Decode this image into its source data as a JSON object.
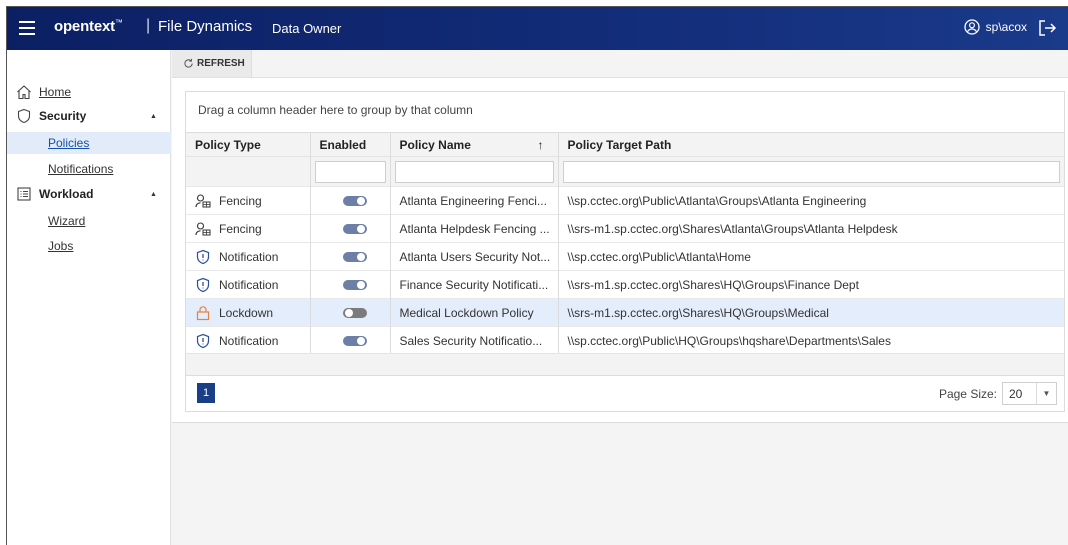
{
  "header": {
    "brand": "opentext",
    "brand_mark": "™",
    "separator": "|",
    "product": "File Dynamics",
    "role": "Data Owner",
    "user": "sp\\acox"
  },
  "sidebar": {
    "home": "Home",
    "security": "Security",
    "policies": "Policies",
    "notifications": "Notifications",
    "workload": "Workload",
    "wizard": "Wizard",
    "jobs": "Jobs"
  },
  "toolbar": {
    "refresh_label": "REFRESH"
  },
  "grid": {
    "group_hint": "Drag a column header here to group by that column",
    "columns": [
      "Policy Type",
      "Enabled",
      "Policy Name",
      "Policy Target Path"
    ],
    "sort_indicator": "↑",
    "rows": [
      {
        "type": "Fencing",
        "icon": "fencing-icon",
        "enabled": true,
        "name": "Atlanta Engineering Fenci...",
        "path": "\\\\sp.cctec.org\\Public\\Atlanta\\Groups\\Atlanta Engineering"
      },
      {
        "type": "Fencing",
        "icon": "fencing-icon",
        "enabled": true,
        "name": "Atlanta Helpdesk Fencing ...",
        "path": "\\\\srs-m1.sp.cctec.org\\Shares\\Atlanta\\Groups\\Atlanta Helpdesk"
      },
      {
        "type": "Notification",
        "icon": "shield-icon",
        "enabled": true,
        "name": "Atlanta Users Security Not...",
        "path": "\\\\sp.cctec.org\\Public\\Atlanta\\Home"
      },
      {
        "type": "Notification",
        "icon": "shield-icon",
        "enabled": true,
        "name": "Finance Security Notificati...",
        "path": "\\\\srs-m1.sp.cctec.org\\Shares\\HQ\\Groups\\Finance Dept"
      },
      {
        "type": "Lockdown",
        "icon": "lock-icon",
        "enabled": false,
        "name": "Medical Lockdown Policy",
        "path": "\\\\srs-m1.sp.cctec.org\\Shares\\HQ\\Groups\\Medical"
      },
      {
        "type": "Notification",
        "icon": "shield-icon",
        "enabled": true,
        "name": "Sales Security Notificatio...",
        "path": "\\\\sp.cctec.org\\Public\\HQ\\Groups\\hqshare\\Departments\\Sales"
      }
    ]
  },
  "pager": {
    "current_page": "1",
    "page_size_label": "Page Size:",
    "page_size": "20"
  },
  "colors": {
    "header_bg": "#122c78",
    "accent": "#1b3f86",
    "lockdown_icon": "#e8823a",
    "shield_icon": "#2d4e9a"
  }
}
